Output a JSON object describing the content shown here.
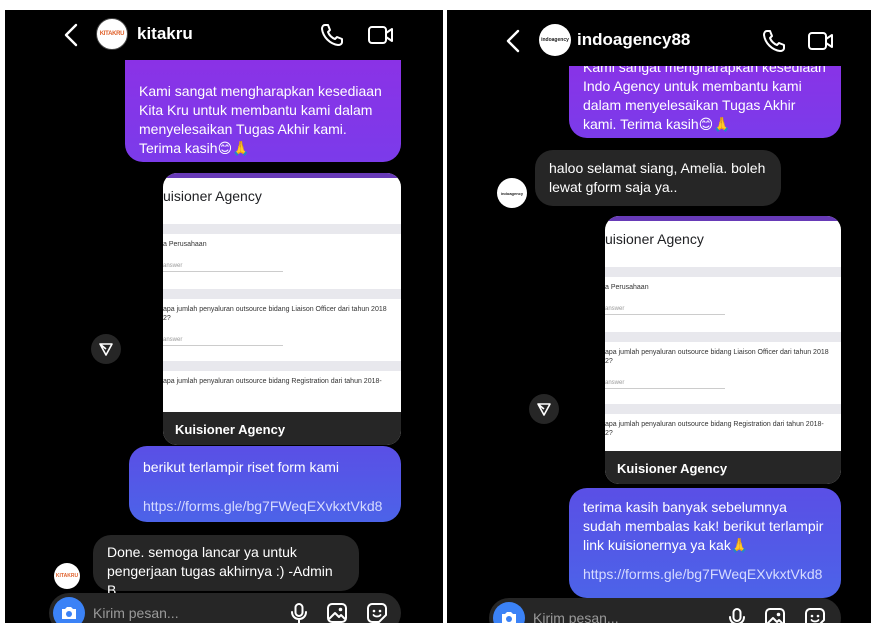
{
  "left": {
    "username": "kitakru",
    "avatar_text": "KITAKRU",
    "sent_intro": "Kami sangat mengharapkan kesediaan Kita Kru untuk membantu kami dalam menyelesaikan Tugas Akhir kami. Terima kasih😊🙏",
    "form_preview": {
      "title": "uisioner Agency",
      "q1": "a Perusahaan",
      "q1_answer": "answer",
      "q2": "apa jumlah penyaluran outsource bidang Liaison Officer dari tahun 2018\n2?",
      "q2_answer": "answer",
      "q3": "apa jumlah penyaluran outsource bidang Registration dari tahun 2018-",
      "footer": "Kuisioner Agency"
    },
    "sent_link_text": "berikut terlampir riset form kami",
    "sent_link_url": "https://forms.gle/bg7FWeqEXvkxtVkd8",
    "reply": "Done. semoga lancar ya untuk pengerjaan tugas akhirnya :) -Admin B",
    "input_placeholder": "Kirim pesan..."
  },
  "right": {
    "username": "indoagency88",
    "avatar_text": "indoagency",
    "sent_intro": "Kami sangat mengharapkan kesediaan Indo Agency untuk membantu kami dalam menyelesaikan Tugas Akhir kami. Terima kasih😊🙏",
    "reply": "haloo selamat siang, Amelia. boleh lewat gform saja ya..",
    "form_preview": {
      "title": "uisioner Agency",
      "q1": "a Perusahaan",
      "q1_answer": "answer",
      "q2": "apa jumlah penyaluran outsource bidang Liaison Officer dari tahun 2018\n2?",
      "q2_answer": "answer",
      "q3": "apa jumlah penyaluran outsource bidang Registration dari tahun 2018-\n2?",
      "footer": "Kuisioner Agency"
    },
    "sent_link_text": "terima kasih banyak sebelumnya sudah membalas kak! berikut terlampir link kuisionernya ya kak🙏",
    "sent_link_url": "https://forms.gle/bg7FWeqEXvkxtVkd8",
    "input_placeholder": "Kirim pesan..."
  },
  "colors": {
    "accent_purple": "#8b32e6",
    "accent_blue": "#4c63e8",
    "camera_blue": "#3b82f6",
    "bubble_gray": "#262626",
    "background": "#000000"
  },
  "icons": [
    "back-chevron-icon",
    "phone-icon",
    "video-icon",
    "share-icon",
    "camera-icon",
    "microphone-icon",
    "gallery-icon",
    "sticker-icon"
  ]
}
